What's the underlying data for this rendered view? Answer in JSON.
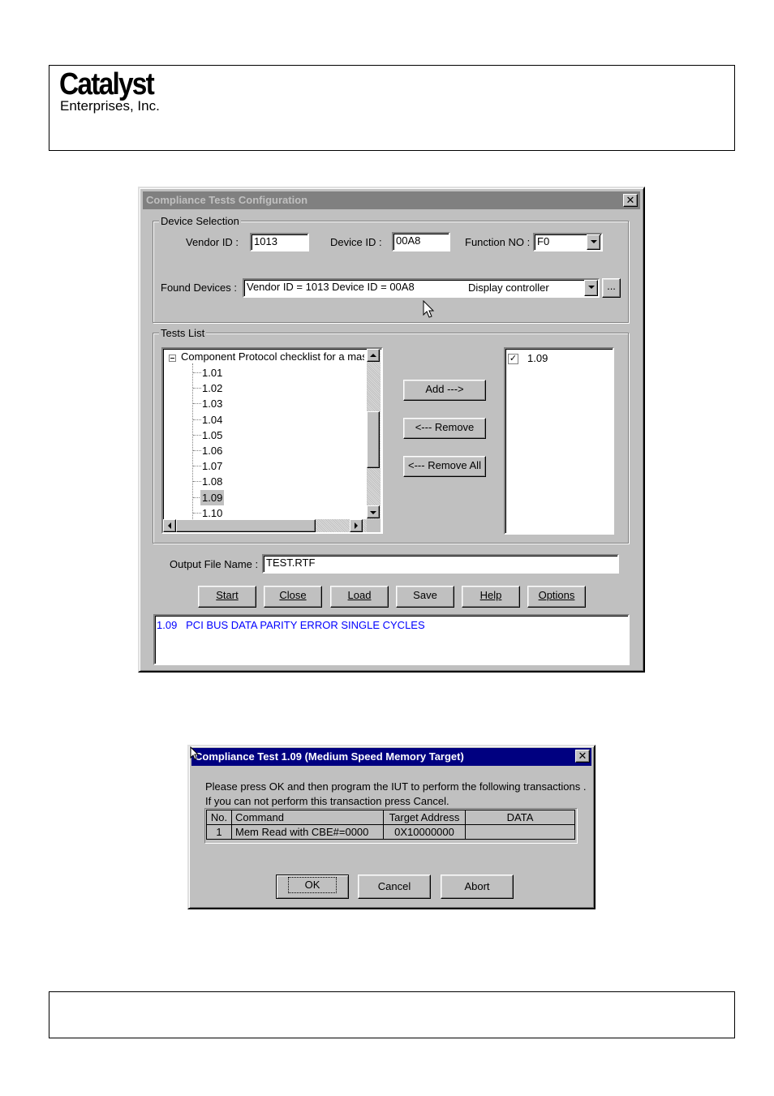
{
  "header": {
    "logo_main": "Catalyst",
    "logo_sub": "Enterprises, Inc."
  },
  "config_dialog": {
    "title": "Compliance Tests Configuration",
    "device_selection": {
      "group_label": "Device Selection",
      "vendor_id_label": "Vendor ID :",
      "vendor_id_value": "1013",
      "device_id_label": "Device ID :",
      "device_id_value": "00A8",
      "function_no_label": "Function NO :",
      "function_no_value": "F0",
      "found_devices_label": "Found Devices :",
      "found_devices_value": "Vendor ID = 1013 Device ID = 00A8",
      "found_devices_type": "Display controller",
      "browse_label": "..."
    },
    "tests_list": {
      "group_label": "Tests List",
      "tree_root": "Component Protocol checklist for a mas",
      "tree_items": [
        "1.01",
        "1.02",
        "1.03",
        "1.04",
        "1.05",
        "1.06",
        "1.07",
        "1.08",
        "1.09",
        "1.10"
      ],
      "selected_item": "1.09",
      "selected_tests": [
        "1.09"
      ],
      "add_label": "Add --->",
      "remove_label": "<--- Remove",
      "remove_all_label": "<--- Remove All"
    },
    "output_file_label": "Output File Name :",
    "output_file_value": "TEST.RTF",
    "buttons": {
      "start": "Start",
      "close": "Close",
      "load": "Load",
      "save": "Save",
      "help": "Help",
      "options": "Options"
    },
    "description": "1.09   PCI BUS DATA PARITY ERROR SINGLE CYCLES",
    "description_color": "#0000ff"
  },
  "test_dialog": {
    "title": "Compliance Test 1.09 (Medium Speed Memory Target)",
    "message_line1": "Please press OK and then program the IUT to perform the following transactions .",
    "message_line2": "If you can not perform this transaction press Cancel.",
    "table": {
      "headers": [
        "No.",
        "Command",
        "Target Address",
        "DATA"
      ],
      "rows": [
        [
          "1",
          "Mem Read with CBE#=0000",
          "0X10000000",
          ""
        ]
      ]
    },
    "ok_label": "OK",
    "cancel_label": "Cancel",
    "abort_label": "Abort"
  }
}
